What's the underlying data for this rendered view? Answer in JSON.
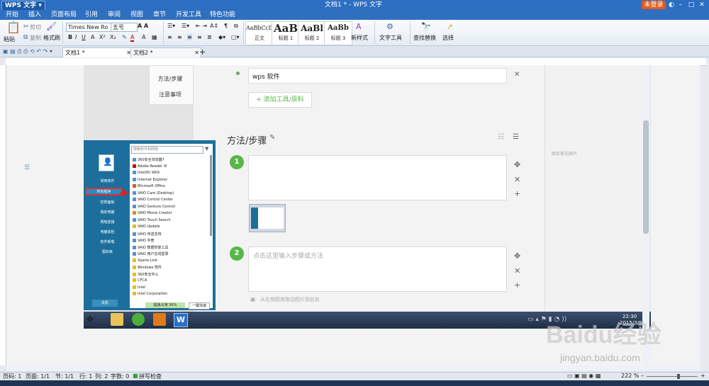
{
  "title_bar": {
    "app_menu": "WPS 文字",
    "doc_title": "文档1 * - WPS 文字",
    "login": "未登录"
  },
  "menu": [
    "开始",
    "插入",
    "页面布局",
    "引用",
    "审阅",
    "视图",
    "章节",
    "开发工具",
    "特色功能"
  ],
  "ribbon": {
    "paste": "粘贴",
    "cut": "剪切",
    "copy": "复制",
    "format_painter": "格式刷",
    "font_name": "Times New Ro",
    "font_size": "五号",
    "styles": [
      {
        "preview": "AaBbCcDd",
        "name": "正文"
      },
      {
        "preview": "AaB",
        "name": "标题 1"
      },
      {
        "preview": "AaBl",
        "name": "标题 2"
      },
      {
        "preview": "AaBb",
        "name": "标题 3"
      }
    ],
    "new_style": "新样式",
    "text_tools": "文字工具",
    "find_replace": "查找替换",
    "select": "选择"
  },
  "tabs": [
    "文档1 *",
    "文档2 *"
  ],
  "web": {
    "sidebar_links": [
      "方法/步骤",
      "注意事项"
    ],
    "tool_item": "wps 软件",
    "add_tool": "+ 添加工具/原料",
    "section_title": "方法/步骤",
    "step1": "1",
    "step2": "2",
    "step2_placeholder": "点击这里输入步骤或方法",
    "drag_hint": "从右侧图库拖动图片到此处",
    "right_panel_text": "图库暂无图片"
  },
  "start_menu": {
    "search_placeholder": "搜索软件和网络",
    "left_items": [
      "常用软件",
      "所有程序",
      "控制面板",
      "我的电脑",
      "网络连接",
      "电脑体检",
      "软件卸载",
      "图标板"
    ],
    "programs": [
      "360安全浏览器7",
      "Adobe Reader XI",
      "Intel(R) WiDi",
      "Internet Explorer",
      "Microsoft Office",
      "VAIO Care (Desktop)",
      "VAIO Control Center",
      "VAIO Gesture Control",
      "VAIO Movie Creator",
      "VAIO Touch Search",
      "VAIO Update",
      "VAIO 传送支持",
      "VAIO 手册",
      "VAIO 数据恢复工具",
      "VAIO 用户在线登录",
      "Xperia Link",
      "Windows 附件",
      "360安全中心",
      "CFCA",
      "Intel",
      "Intel Corporation"
    ],
    "shutdown": "关机",
    "speed": "提速占用 56%",
    "speed_btn": "一键加速"
  },
  "taskbar": {
    "time": "22:30",
    "date": "2015/3/9"
  },
  "watermark": {
    "line1": "Baidu经验",
    "line2": "jingyan.baidu.com"
  },
  "status": {
    "page_code": "页码: 1",
    "pages": "页面: 1/1",
    "section": "节: 1/1",
    "row": "行: 1",
    "col": "列: 2",
    "words": "字数: 0",
    "spell": "拼写检查",
    "zoom": "222 %"
  },
  "colors": {
    "titlebar": "#2c6fc2",
    "accent_green": "#58b64a",
    "start_menu": "#1c6f9c",
    "login": "#e05a1c"
  }
}
